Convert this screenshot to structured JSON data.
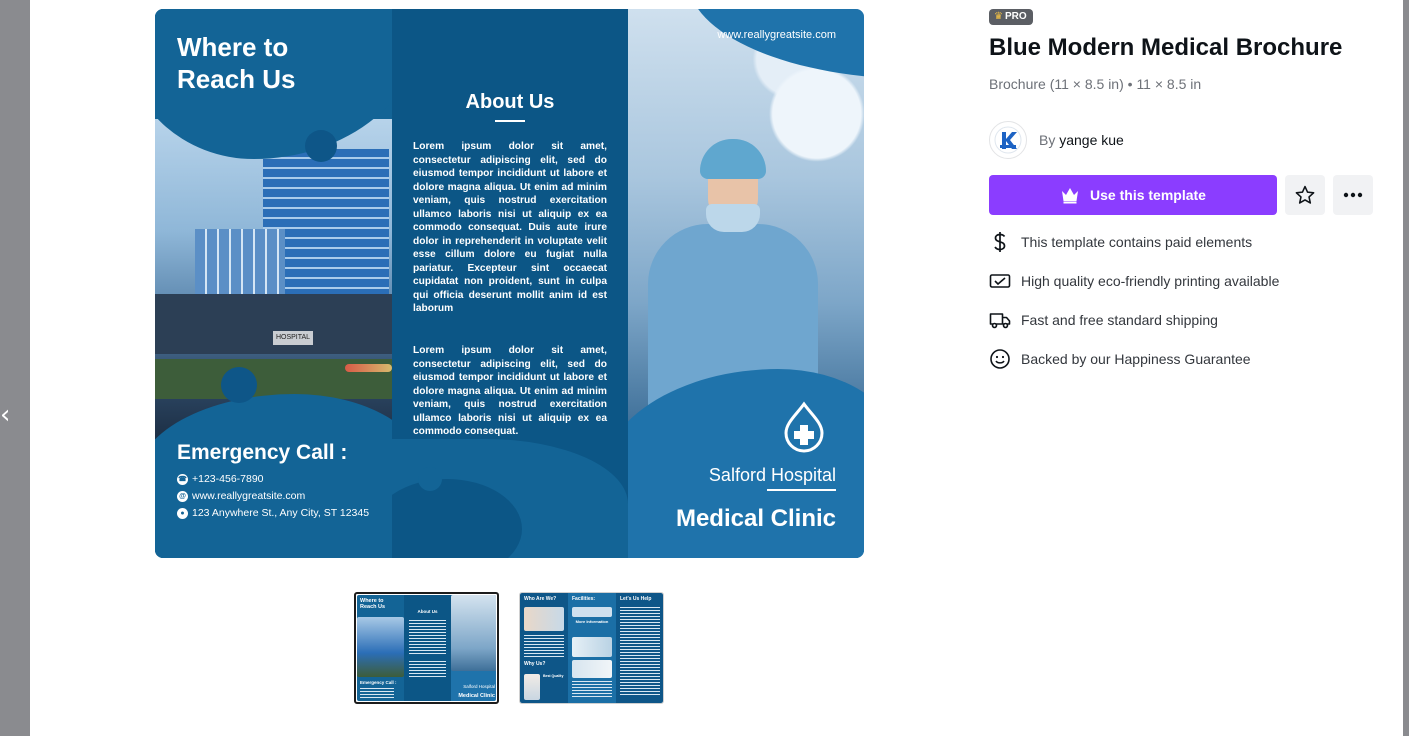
{
  "template": {
    "badge": "PRO",
    "title": "Blue Modern Medical Brochure",
    "subtitle": "Brochure (11 × 8.5 in) • 11 × 8.5 in",
    "author_prefix": "By",
    "author_name": "yange kue",
    "use_button": "Use this template"
  },
  "features": [
    {
      "icon": "dollar-icon",
      "text": "This template contains paid elements"
    },
    {
      "icon": "print-icon",
      "text": "High quality eco-friendly printing available"
    },
    {
      "icon": "truck-icon",
      "text": "Fast and free standard shipping"
    },
    {
      "icon": "smile-icon",
      "text": "Backed by our Happiness Guarantee"
    }
  ],
  "brochure": {
    "panel1": {
      "title": "Where to Reach Us",
      "building_sign": "HOSPITAL",
      "emergency": "Emergency Call :",
      "phone": "+123-456-7890",
      "web": "www.reallygreatsite.com",
      "address": "123 Anywhere St., Any City, ST 12345"
    },
    "panel2": {
      "title": "About Us",
      "para1": "Lorem ipsum dolor sit amet, consectetur adipiscing elit, sed do eiusmod tempor incididunt ut labore et dolore magna aliqua. Ut enim ad minim veniam, quis nostrud exercitation ullamco laboris nisi ut aliquip ex ea commodo consequat. Duis aute irure dolor in reprehenderit in voluptate velit esse cillum dolore eu fugiat nulla pariatur. Excepteur sint occaecat cupidatat non proident, sunt in culpa qui officia deserunt mollit anim id est laborum",
      "para2": "Lorem ipsum dolor sit amet, consectetur adipiscing elit, sed do eiusmod tempor incididunt ut labore et dolore magna aliqua. Ut enim ad minim veniam, quis nostrud exercitation ullamco laboris nisi ut aliquip ex ea commodo consequat."
    },
    "panel3": {
      "url": "www.reallygreatsite.com",
      "hospital": "Salford Hospital",
      "clinic": "Medical Clinic"
    }
  },
  "thumbnails": {
    "page1": {
      "title": "Where to Reach Us",
      "about": "About Us",
      "emergency": "Emergency Call :",
      "hospital": "Salford Hospital",
      "clinic": "Medical Clinic"
    },
    "page2": {
      "who": "Who Are We?",
      "facilities": "Facilities:",
      "help": "Let's Us Help",
      "more": "More Information",
      "why": "Why Us?",
      "quality": "Best Quality"
    }
  },
  "colors": {
    "accent": "#8b3dff",
    "brochure_blue": "#136496",
    "badge_bg": "#5b5e64"
  }
}
